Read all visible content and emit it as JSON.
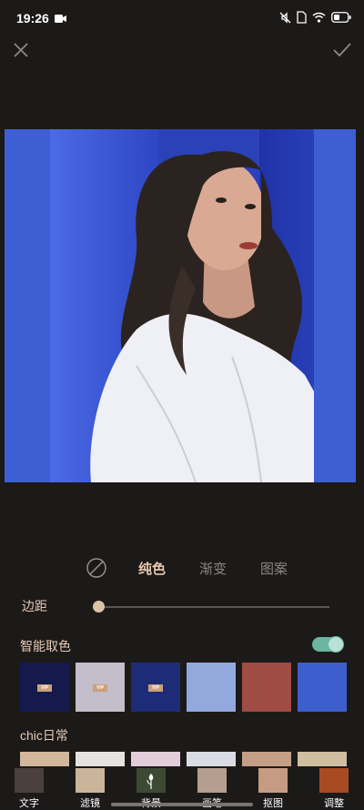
{
  "status_bar": {
    "time": "19:26"
  },
  "editor": {
    "close_icon": "close-icon",
    "confirm_icon": "check-icon"
  },
  "background_tabs": {
    "none_icon": "no-background-icon",
    "items": [
      {
        "label": "纯色",
        "active": true
      },
      {
        "label": "渐变",
        "active": false
      },
      {
        "label": "图案",
        "active": false
      }
    ]
  },
  "margin": {
    "label": "边距",
    "value": 0
  },
  "smart_color": {
    "label": "智能取色",
    "enabled": true,
    "swatches": [
      {
        "color": "#151a4d",
        "vip": true
      },
      {
        "color": "#c2bdc8",
        "vip": true
      },
      {
        "color": "#1e2c77",
        "vip": true
      },
      {
        "color": "#93a8dd",
        "vip": false
      },
      {
        "color": "#a04c44",
        "vip": false
      },
      {
        "color": "#3d5fce",
        "vip": false
      }
    ],
    "vip_text": "VIP"
  },
  "chic": {
    "label": "chic日常",
    "swatches": [
      "#d2b79a",
      "#e6e2e0",
      "#e3cdd9",
      "#dadce4",
      "#c49f86",
      "#cfbea0"
    ]
  },
  "bottom_nav": [
    {
      "label": "文字",
      "color": "#4a403e"
    },
    {
      "label": "滤镜",
      "color": "#cbb59a"
    },
    {
      "label": "背景",
      "color": "#3d4a33",
      "icon": "flower-icon"
    },
    {
      "label": "画笔",
      "color": "#b59d8f"
    },
    {
      "label": "抠图",
      "color": "#c59b84"
    },
    {
      "label": "调整",
      "color": "#a84a22"
    }
  ]
}
